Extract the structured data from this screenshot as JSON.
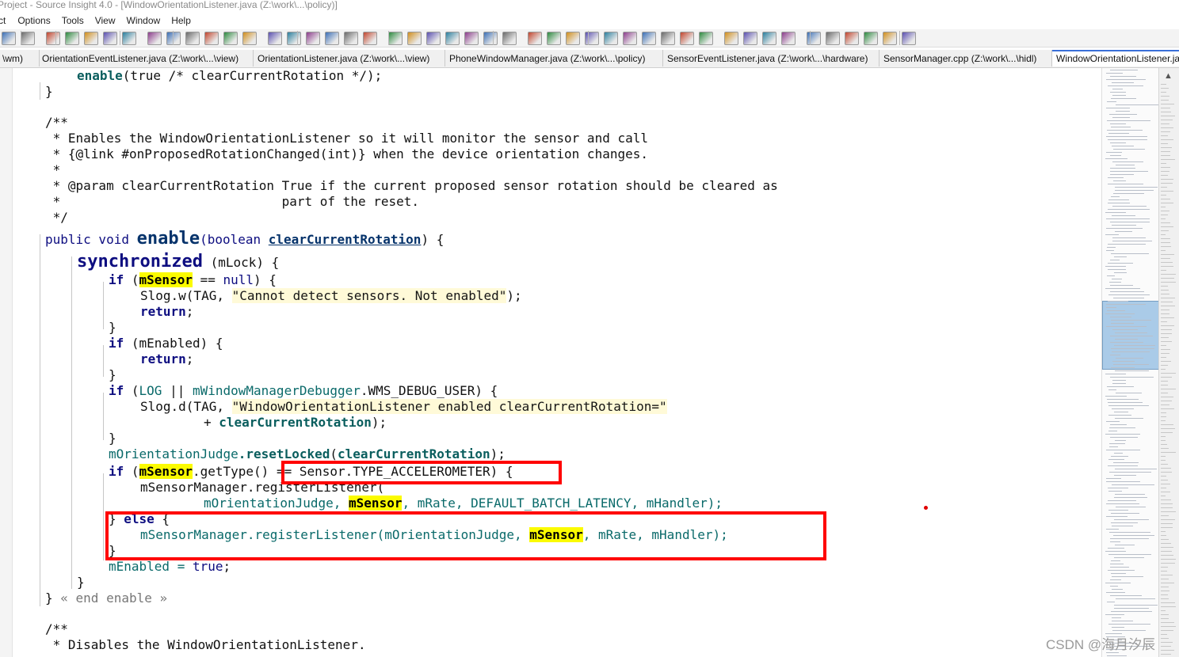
{
  "window": {
    "title": "Project - Source Insight 4.0 - [WindowOrientationListener.java (Z:\\work\\...\\policy)]"
  },
  "menu": [
    "ct",
    "Options",
    "Tools",
    "View",
    "Window",
    "Help"
  ],
  "toolbar_icons": [
    "save-all-icon",
    "print-icon",
    "cut-icon",
    "copy-icon",
    "paste-icon",
    "undo-icon",
    "redo-icon",
    "find-icon",
    "jump-icon",
    "jump-back-icon",
    "jump-forward-icon",
    "xy-icon",
    "www-icon",
    "bookmark-icon",
    "bookmark2-icon",
    "browse-icon",
    "up-icon",
    "symbol-icon",
    "lookup-icon",
    "ref-icon",
    "fx-icon",
    "relation-icon",
    "layout1-icon",
    "layout2-icon",
    "layout3-icon",
    "layout4-icon",
    "project-icon",
    "diff-icon",
    "doc-icon",
    "tree1-icon",
    "help-icon",
    "window-icon",
    "context-icon",
    "sync-icon",
    "sync2-icon",
    "grid-icon",
    "add-icon",
    "add2-icon",
    "remove-icon",
    "delete-icon",
    "a-icon",
    "b-icon",
    "c-icon",
    "d-icon",
    "e-icon",
    "f-icon"
  ],
  "tabs": [
    {
      "label": "\\wm)"
    },
    {
      "label": "OrientationEventListener.java (Z:\\work\\...\\view)"
    },
    {
      "label": "OrientationListener.java (Z:\\work\\...\\view)"
    },
    {
      "label": "PhoneWindowManager.java (Z:\\work\\...\\policy)"
    },
    {
      "label": "SensorEventListener.java (Z:\\work\\...\\hardware)"
    },
    {
      "label": "SensorManager.cpp (Z:\\work\\...\\hidl)"
    },
    {
      "label": "WindowOrientationListener.java"
    }
  ],
  "code": {
    "l1_call": "enable",
    "l1_rest": "(true /* clearCurrentRotation */);",
    "l2": "}",
    "c1": "/**",
    "c2": " * Enables the WindowOrientationListener so it will monitor the sensor and call",
    "c3": " * {@link #onProposedRotationChanged(int)} when the device orientation changes.",
    "c4": " *",
    "c5": " * @param clearCurrentRotation True if the current proposed sensor rotation should be cleared as",
    "c6": " *                             part of the reset.",
    "c7": " */",
    "sig_mod": "public void ",
    "sig_name": "enable",
    "sig_open": "(boolean ",
    "sig_param": "clearCurrentRotation",
    "sig_close": ") {",
    "sync_kw": "synchronized",
    "sync_rest": " (mLock) {",
    "if1_kw": "if",
    "if1_a": " (",
    "msensor": "mSensor",
    "if1_b": " == ",
    "null_kw": "null",
    "if1_c": ") {",
    "slogw_a": "Slog.w(TAG, ",
    "slogw_str": "\"Cannot detect sensors. Not enabled\"",
    "slogw_b": ");",
    "return_kw": "return",
    "semi": ";",
    "rbrace": "}",
    "if2_kw": "if",
    "if2_rest": " (mEnabled) {",
    "if3_kw": "if",
    "if3_a": " (",
    "log_var": "LOG",
    "if3_b": " || ",
    "dbg_var": "mWindowManagerDebugger",
    "if3_c": ".WMS_DEBUG_USER) {",
    "slogd_a": "Slog.d(TAG, ",
    "slogd_str": "\"WindowOrientationListener enabled clearCurrentRotation=\"",
    "plus": "+ ",
    "ccr": "clearCurrentRotation",
    "close_paren_semi": ");",
    "judge_var": "mOrientationJudge",
    "reset_call": ".resetLocked",
    "reset_open": "(",
    "if4_kw": "if",
    "if4_a": " (",
    "gettype": ".getType() ",
    "if4_b": "== Sensor.TYPE_ACCELEROMETER) {",
    "reg1": "mSensorManager.registerListener(",
    "reg2_a": "mOrientationJudge, ",
    "reg2_b": ", mRate, DEFAULT_BATCH_LATENCY, mHandler);",
    "else_brace": "} ",
    "else_kw": "else",
    "else_open": " {",
    "reg3_a": "mSensorManager.registerListener(mOrientationJudge, ",
    "reg3_b": ", mRate, mHandler);",
    "enabled_a": "mEnabled = ",
    "true_kw": "true",
    "end_a": "} ",
    "end_comment": "« end enable »",
    "d1": "/**",
    "d2": " * Disables the WindowOrientationListener."
  },
  "watermark": "CSDN @海月汐辰"
}
